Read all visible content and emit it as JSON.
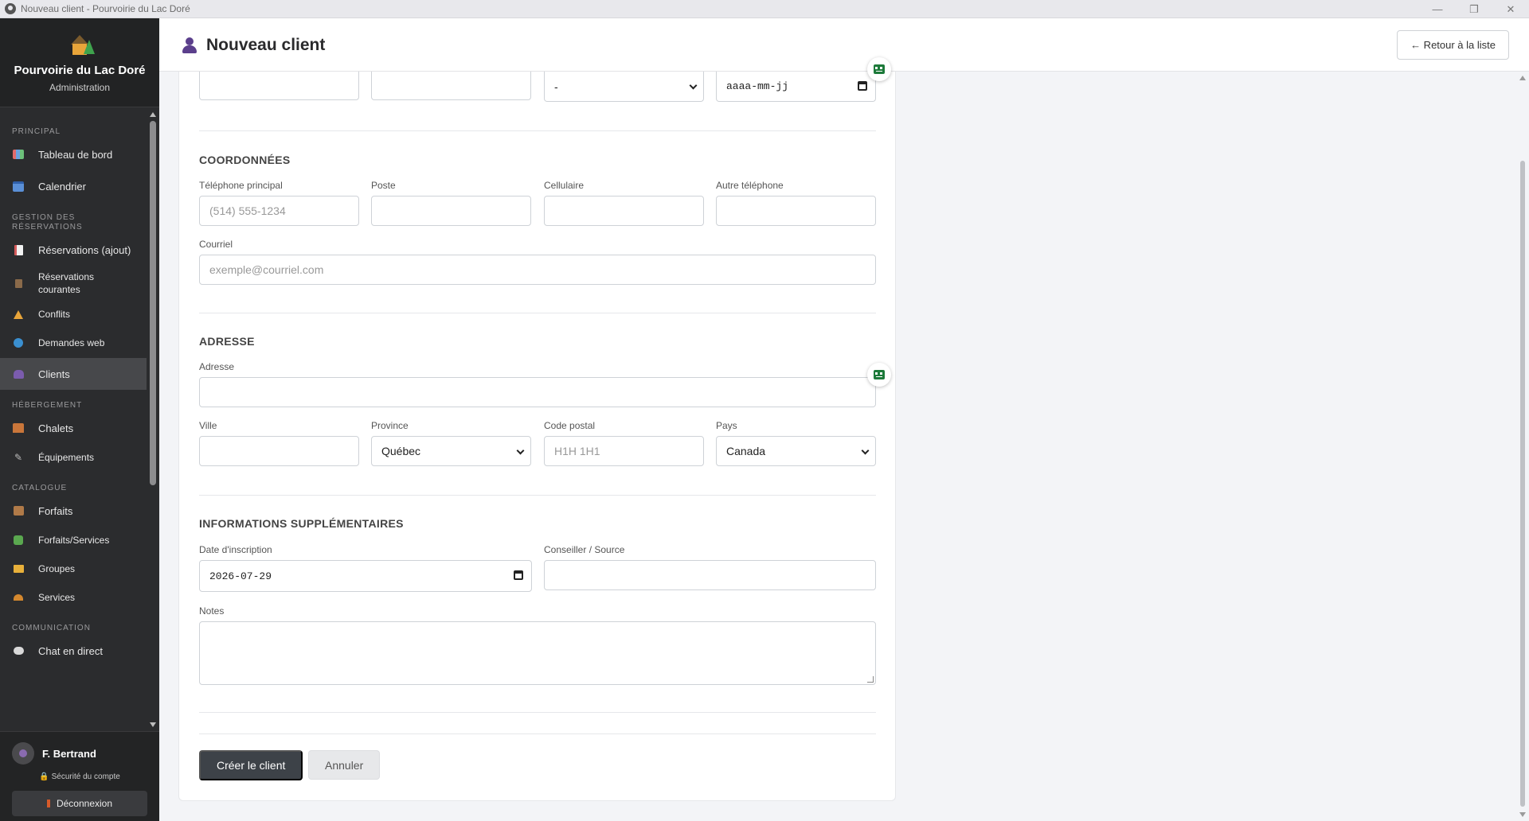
{
  "window": {
    "title": "Nouveau client - Pourvoirie du Lac Doré",
    "controls": {
      "minimize": "—",
      "restore": "❐",
      "close": "✕"
    }
  },
  "brand": {
    "name": "Pourvoirie du Lac Doré",
    "subtitle": "Administration"
  },
  "sidebar": {
    "sections": [
      {
        "label": "Principal",
        "items": [
          {
            "label": "Tableau de bord",
            "icon": "chart-icon"
          },
          {
            "label": "Calendrier",
            "icon": "calendar-icon"
          }
        ]
      },
      {
        "label": "Gestion des réservations",
        "items": [
          {
            "label": "Réservations (ajout)",
            "icon": "memo-icon"
          },
          {
            "label": "Réservations courantes",
            "icon": "clipboard-icon"
          },
          {
            "label": "Conflits",
            "icon": "warning-icon"
          },
          {
            "label": "Demandes web",
            "icon": "globe-icon"
          },
          {
            "label": "Clients",
            "icon": "people-icon"
          }
        ]
      },
      {
        "label": "Hébergement",
        "items": [
          {
            "label": "Chalets",
            "icon": "cabin-icon"
          },
          {
            "label": "Équipements",
            "icon": "wrench-icon"
          }
        ]
      },
      {
        "label": "Catalogue",
        "items": [
          {
            "label": "Forfaits",
            "icon": "package-icon"
          },
          {
            "label": "Forfaits/Services",
            "icon": "puzzle-icon"
          },
          {
            "label": "Groupes",
            "icon": "folder-icon"
          },
          {
            "label": "Services",
            "icon": "bell-icon"
          }
        ]
      },
      {
        "label": "Communication",
        "items": [
          {
            "label": "Chat en direct",
            "icon": "chat-icon"
          }
        ]
      }
    ],
    "active_item": "Clients"
  },
  "user": {
    "name": "F. Bertrand",
    "security_link": "Sécurité du compte",
    "logout_label": "Déconnexion"
  },
  "header": {
    "title": "Nouveau client",
    "back_button": "← Retour à la liste"
  },
  "form": {
    "top_row": {
      "field1_value": "",
      "field2_value": "",
      "select_value": "-",
      "date_placeholder": "aaaa-mm-jj"
    },
    "coordonnees": {
      "title": "COORDONNÉES",
      "phone_label": "Téléphone principal",
      "phone_placeholder": "(514) 555-1234",
      "ext_label": "Poste",
      "cell_label": "Cellulaire",
      "other_phone_label": "Autre téléphone",
      "email_label": "Courriel",
      "email_placeholder": "exemple@courriel.com"
    },
    "adresse": {
      "title": "ADRESSE",
      "address_label": "Adresse",
      "city_label": "Ville",
      "province_label": "Province",
      "province_value": "Québec",
      "postal_label": "Code postal",
      "postal_placeholder": "H1H 1H1",
      "country_label": "Pays",
      "country_value": "Canada"
    },
    "supplementaires": {
      "title": "INFORMATIONS SUPPLÉMENTAIRES",
      "signup_date_label": "Date d'inscription",
      "signup_date_value": "2026-07-29",
      "advisor_label": "Conseiller / Source",
      "notes_label": "Notes"
    },
    "actions": {
      "submit": "Créer le client",
      "cancel": "Annuler"
    }
  },
  "colors": {
    "sidebar_bg": "#2b2c2e",
    "sidebar_active": "#47484b",
    "primary_button": "#3d4248",
    "page_bg": "#f3f4f7"
  }
}
